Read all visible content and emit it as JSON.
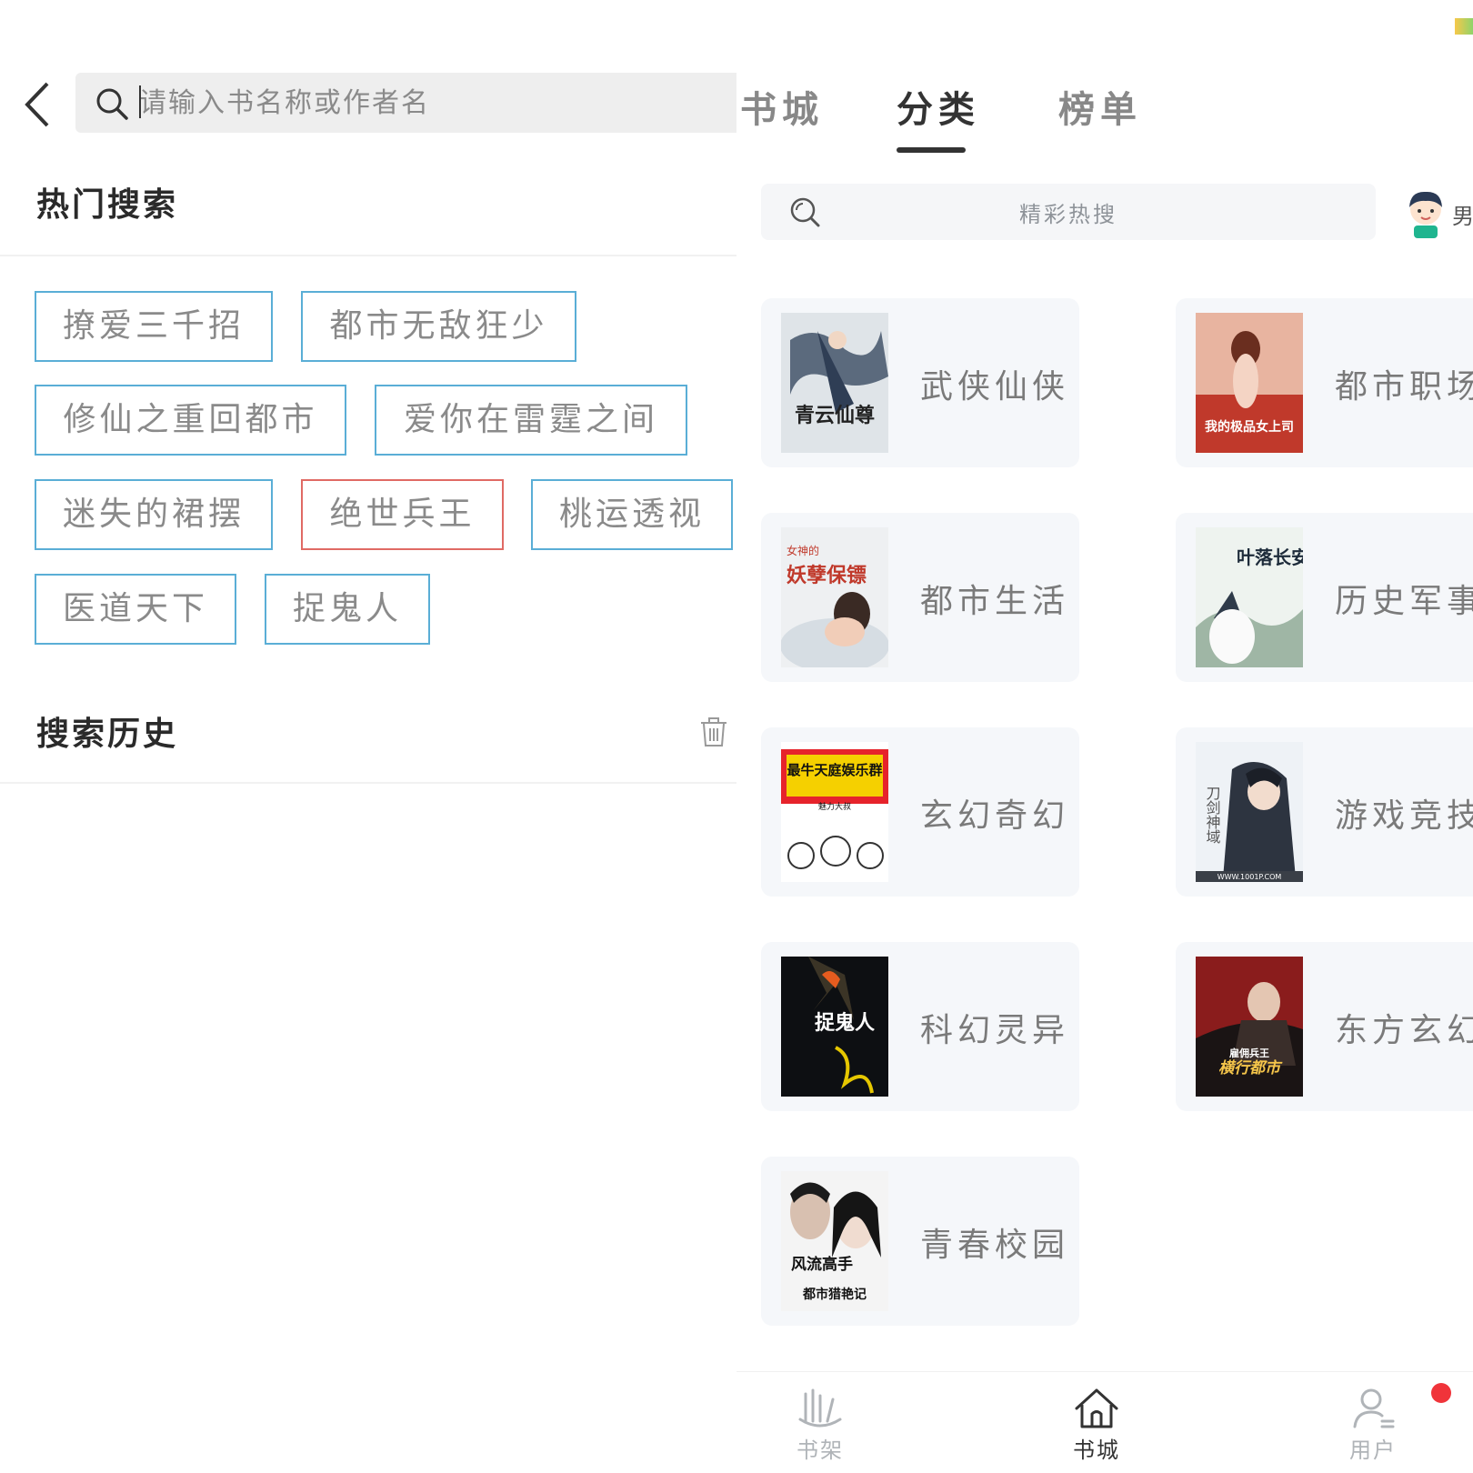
{
  "search": {
    "placeholder": "请输入书名称或作者名"
  },
  "hot_search": {
    "title": "热门搜索",
    "tags": [
      {
        "label": "撩爱三千招",
        "color": "#5aaed6"
      },
      {
        "label": "都市无敌狂少",
        "color": "#5aaed6"
      },
      {
        "label": "修仙之重回都市",
        "color": "#5aaed6"
      },
      {
        "label": "爱你在雷霆之间",
        "color": "#5aaed6"
      },
      {
        "label": "迷失的裙摆",
        "color": "#5aaed6"
      },
      {
        "label": "绝世兵王",
        "color": "#e06a64"
      },
      {
        "label": "桃运透视",
        "color": "#5aaed6"
      },
      {
        "label": "医道天下",
        "color": "#5aaed6"
      },
      {
        "label": "捉鬼人",
        "color": "#5aaed6"
      }
    ]
  },
  "history": {
    "title": "搜索历史",
    "clear_icon": "trash-icon"
  },
  "right": {
    "tabs": [
      {
        "label": "书城",
        "active": false
      },
      {
        "label": "分类",
        "active": true
      },
      {
        "label": "榜单",
        "active": false
      }
    ],
    "hot_search_label": "精彩热搜",
    "gender_label": "男",
    "categories": [
      {
        "name": "武侠仙侠"
      },
      {
        "name": "都市职场"
      },
      {
        "name": "都市生活"
      },
      {
        "name": "历史军事"
      },
      {
        "name": "玄幻奇幻"
      },
      {
        "name": "游戏竞技"
      },
      {
        "name": "科幻灵异"
      },
      {
        "name": "东方玄幻"
      },
      {
        "name": "青春校园"
      }
    ],
    "covers": [
      {
        "title_text": "青云仙尊"
      },
      {
        "title_text": "我的极品女上司"
      },
      {
        "title_text": "妖孽保镖",
        "extra_text": "女神的"
      },
      {
        "title_text": "叶落长安"
      },
      {
        "title_text": "最牛天庭娱乐群",
        "extra_text": "魅力大叔"
      },
      {
        "title_text": "刀剑神域",
        "extra_text": "WWW.1001P.COM"
      },
      {
        "title_text": "捉鬼人"
      },
      {
        "title_text": "横行都市",
        "extra_text": "雇佣兵王"
      },
      {
        "title_text": "风流高手",
        "extra_text": "都市猎艳记"
      }
    ],
    "bottom_nav": [
      {
        "label": "书架",
        "icon": "bookshelf-icon",
        "active": false
      },
      {
        "label": "书城",
        "icon": "home-icon",
        "active": true
      },
      {
        "label": "用户",
        "icon": "user-icon",
        "active": false
      }
    ],
    "accent": "#333333"
  }
}
